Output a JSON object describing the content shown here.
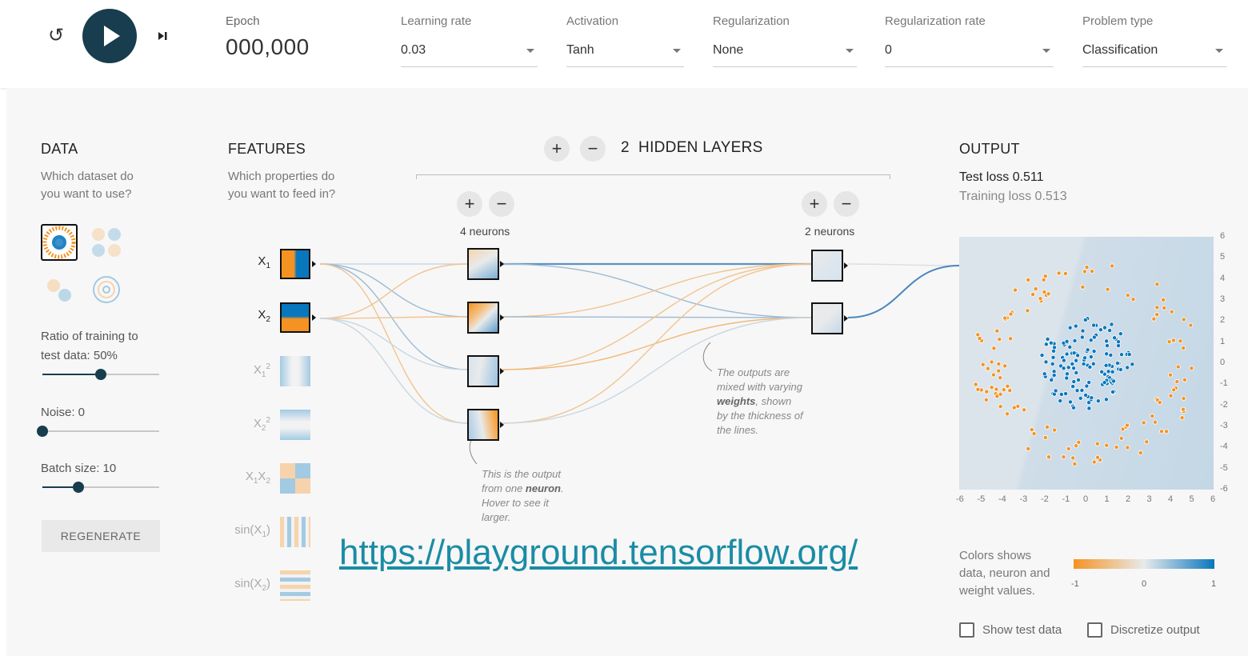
{
  "controls": {
    "epoch_label": "Epoch",
    "epoch_value": "000,000",
    "learning_rate": {
      "label": "Learning rate",
      "value": "0.03"
    },
    "activation": {
      "label": "Activation",
      "value": "Tanh"
    },
    "regularization": {
      "label": "Regularization",
      "value": "None"
    },
    "regularization_rate": {
      "label": "Regularization rate",
      "value": "0"
    },
    "problem_type": {
      "label": "Problem type",
      "value": "Classification"
    }
  },
  "data": {
    "title": "DATA",
    "subtitle_1": "Which dataset do",
    "subtitle_2": "you want to use?",
    "ratio_label_1": "Ratio of training to",
    "ratio_label_2": "test data:  50%",
    "ratio_value": 0.5,
    "noise_label": "Noise:  0",
    "noise_value": 0,
    "batch_label": "Batch size:  10",
    "batch_value": 10,
    "regenerate": "REGENERATE"
  },
  "features": {
    "title": "FEATURES",
    "subtitle_1": "Which properties do",
    "subtitle_2": "you want to feed in?"
  },
  "hidden": {
    "plus": "+",
    "minus": "−",
    "count": "2",
    "label": "HIDDEN LAYERS",
    "layer1_count": "4 neurons",
    "layer2_count": "2 neurons"
  },
  "annotations": {
    "neuron_1": "This is the output",
    "neuron_2a": "from one ",
    "neuron_2b": "neuron",
    "neuron_2c": ".",
    "neuron_3": "Hover to see it",
    "neuron_4": "larger.",
    "weights_1": "The outputs are",
    "weights_2": "mixed with varying",
    "weights_3a": "weights",
    "weights_3b": ", shown",
    "weights_4": "by the thickness of",
    "weights_5": "the lines."
  },
  "output": {
    "title": "OUTPUT",
    "test_loss": "Test loss 0.511",
    "training_loss": "Training loss 0.513",
    "colors_text_1": "Colors shows",
    "colors_text_2": "data, neuron and",
    "colors_text_3": "weight values.",
    "cbar_min": "-1",
    "cbar_mid": "0",
    "cbar_max": "1",
    "show_test": "Show test data",
    "discretize": "Discretize output"
  },
  "url": "https://playground.tensorflow.org/",
  "colors": {
    "orange": "#f59322",
    "blue": "#0877bd",
    "dark": "#183d4e"
  }
}
